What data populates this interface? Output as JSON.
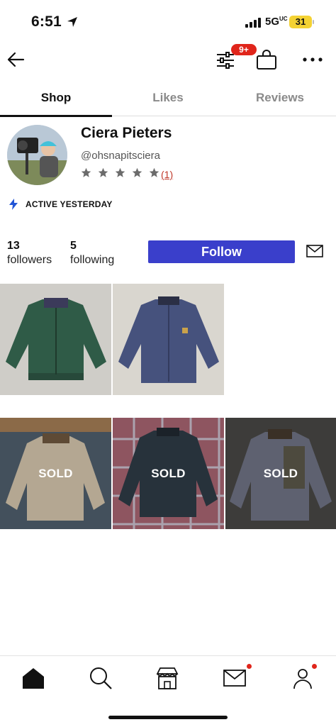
{
  "status_bar": {
    "time": "6:51",
    "network": "5G",
    "network_sup": "UC",
    "battery": "31"
  },
  "header": {
    "cart_badge": "9+"
  },
  "tabs": [
    {
      "label": "Shop"
    },
    {
      "label": "Likes"
    },
    {
      "label": "Reviews"
    }
  ],
  "profile": {
    "name": "Ciera Pieters",
    "handle": "@ohsnapitsciera",
    "rating": 5,
    "review_count": "(1)",
    "activity": "ACTIVE YESTERDAY",
    "followers_count": "13",
    "followers_label": "followers",
    "following_count": "5",
    "following_label": "following",
    "follow_label": "Follow"
  },
  "listings": [
    {
      "color": "green jacket",
      "sold_label": ""
    },
    {
      "color": "blue jacket",
      "sold_label": ""
    },
    {
      "color": "tan jacket",
      "sold_label": "SOLD"
    },
    {
      "color": "navy jacket",
      "sold_label": "SOLD"
    },
    {
      "color": "grey jacket",
      "sold_label": "SOLD"
    }
  ],
  "colors": {
    "accent": "#3a3fcb",
    "badge": "#e0251b",
    "battery": "#f4d233"
  }
}
